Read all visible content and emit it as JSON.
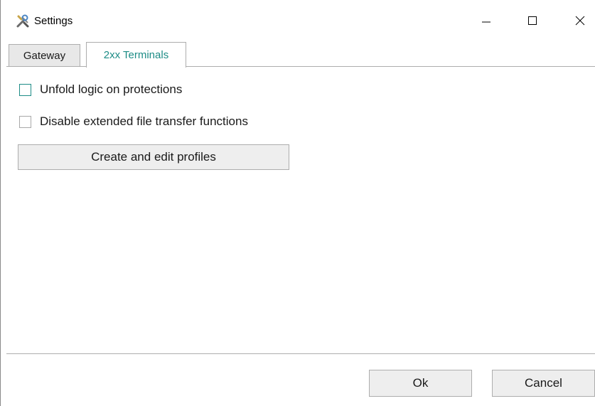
{
  "window": {
    "title": "Settings"
  },
  "tabs": [
    {
      "label": "Gateway",
      "selected": false
    },
    {
      "label": "2xx Terminals",
      "selected": true
    }
  ],
  "options": {
    "unfold_logic": {
      "label": "Unfold logic on protections",
      "checked": false
    },
    "disable_transfer": {
      "label": "Disable extended file transfer functions",
      "checked": false
    }
  },
  "profiles_button": {
    "label": "Create and edit profiles"
  },
  "footer": {
    "ok_label": "Ok",
    "cancel_label": "Cancel"
  },
  "colors": {
    "accent": "#1d8c86",
    "border": "#adadad",
    "button_bg": "#eeeeee"
  }
}
